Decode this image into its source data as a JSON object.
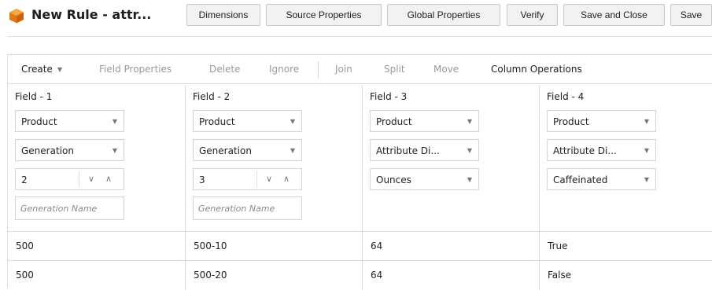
{
  "header": {
    "title": "New Rule - attr...",
    "icon": "cube-icon",
    "buttons": [
      "Dimensions",
      "Source Properties",
      "Global Properties",
      "Verify",
      "Save and Close",
      "Save"
    ]
  },
  "toolbar": {
    "create": "Create",
    "field_properties": "Field Properties",
    "delete": "Delete",
    "ignore": "Ignore",
    "join": "Join",
    "split": "Split",
    "move": "Move",
    "column_operations": "Column Operations"
  },
  "fields": [
    {
      "label": "Field - 1",
      "dimension": "Product",
      "type": "Generation",
      "number": "2",
      "name_placeholder": "Generation Name"
    },
    {
      "label": "Field - 2",
      "dimension": "Product",
      "type": "Generation",
      "number": "3",
      "name_placeholder": "Generation Name"
    },
    {
      "label": "Field - 3",
      "dimension": "Product",
      "type": "Attribute Di...",
      "value": "Ounces"
    },
    {
      "label": "Field - 4",
      "dimension": "Product",
      "type": "Attribute Di...",
      "value": "Caffeinated"
    }
  ],
  "rows": [
    [
      "500",
      "500-10",
      "64",
      "True"
    ],
    [
      "500",
      "500-20",
      "64",
      "False"
    ]
  ],
  "colors": {
    "icon_orange": "#f08a1c",
    "border": "#dcdcdc",
    "button_bg": "#f2f2f2",
    "disabled_text": "#9a9a9a"
  }
}
